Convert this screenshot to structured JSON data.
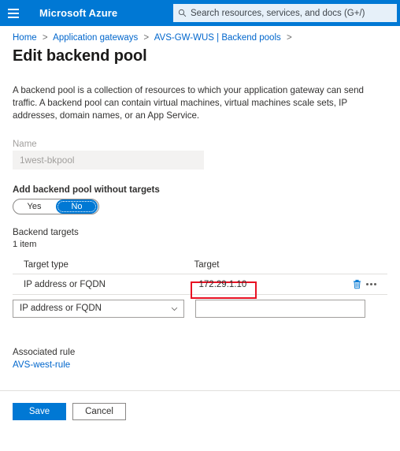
{
  "header": {
    "menu_icon": "hamburger-icon",
    "brand": "Microsoft Azure",
    "search_icon": "search-icon",
    "search_placeholder": "Search resources, services, and docs (G+/)"
  },
  "breadcrumb": {
    "items": [
      "Home",
      "Application gateways",
      "AVS-GW-WUS | Backend pools"
    ],
    "separator": ">",
    "trailing_separator": ">"
  },
  "page": {
    "title": "Edit backend pool",
    "description": "A backend pool is a collection of resources to which your application gateway can send traffic. A backend pool can contain virtual machines, virtual machines scale sets, IP addresses, domain names, or an App Service."
  },
  "name_field": {
    "label": "Name",
    "value": "1west-bkpool",
    "disabled": true
  },
  "targets_toggle": {
    "label": "Add backend pool without targets",
    "options": [
      "Yes",
      "No"
    ],
    "selected": "No"
  },
  "backend_targets": {
    "heading": "Backend targets",
    "count_text": "1 item",
    "columns": [
      "Target type",
      "Target"
    ],
    "rows": [
      {
        "target_type": "IP address or FQDN",
        "target": "172.29.1.10",
        "delete_icon": "trash-icon",
        "more_icon": "ellipsis-icon",
        "highlighted": true
      }
    ],
    "editor": {
      "type_select_value": "IP address or FQDN",
      "type_select_chevron": "chevron-down-icon",
      "target_input_value": "",
      "target_input_placeholder": ""
    }
  },
  "associated_rule": {
    "label": "Associated rule",
    "link": "AVS-west-rule"
  },
  "footer": {
    "save_label": "Save",
    "cancel_label": "Cancel"
  },
  "colors": {
    "azure_blue": "#0078d4",
    "link_blue": "#0066cc",
    "highlight_red": "#e81123"
  }
}
